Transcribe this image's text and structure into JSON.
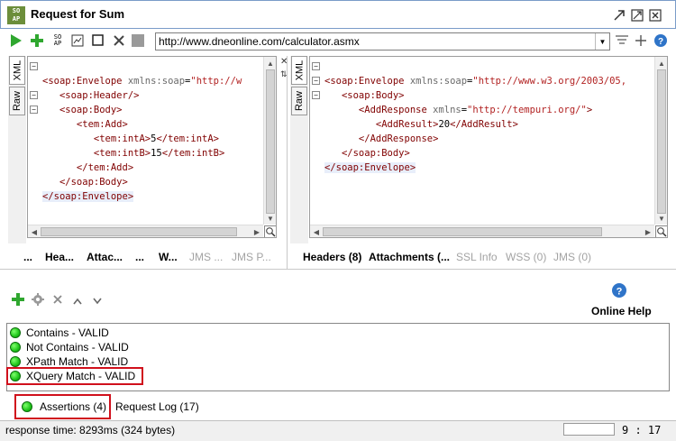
{
  "window": {
    "title": "Request for Sum",
    "app_icon_text": "SO AP"
  },
  "toolbar": {
    "url": "http://www.dneonline.com/calculator.asmx",
    "icons": [
      "run-icon",
      "add-icon",
      "soap-icon",
      "format-icon",
      "stop-icon",
      "cancel-icon",
      "gear-filter-icon",
      "plus-icon",
      "help-icon"
    ]
  },
  "request_editor": {
    "side_tabs": [
      "XML",
      "Raw"
    ],
    "lines": [
      "<soap:Envelope xmlns:soap=\"http://w",
      "   <soap:Header/>",
      "   <soap:Body>",
      "      <tem:Add>",
      "         <tem:intA>5</tem:intA>",
      "         <tem:intB>15</tem:intB>",
      "      </tem:Add>",
      "   </soap:Body>",
      "</soap:Envelope>"
    ],
    "bottom_tabs": [
      "...",
      "Hea...",
      "Attac...",
      "...",
      "W...",
      "JMS ...",
      "JMS P..."
    ]
  },
  "response_editor": {
    "side_tabs": [
      "XML",
      "Raw"
    ],
    "lines": [
      "<soap:Envelope xmlns:soap=\"http://www.w3.org/2003/05,",
      "   <soap:Body>",
      "      <AddResponse xmlns=\"http://tempuri.org/\">",
      "         <AddResult>20</AddResult>",
      "      </AddResponse>",
      "   </soap:Body>",
      "</soap:Envelope>"
    ],
    "bottom_tabs": [
      "Headers (8)",
      "Attachments (...",
      "SSL Info",
      "WSS (0)",
      "JMS (0)"
    ]
  },
  "assertions": {
    "online_help": "Online Help",
    "items": [
      "Contains - VALID",
      "Not Contains - VALID",
      "XPath Match - VALID",
      "XQuery Match - VALID"
    ],
    "tabs": {
      "assertions": "Assertions (4)",
      "request_log": "Request Log (17)"
    }
  },
  "status": {
    "response_time": "response time: 8293ms (324 bytes)",
    "position": "9 : 17"
  },
  "colors": {
    "accent_red": "#d0101c",
    "valid_green": "#1fc51a",
    "tag": "#800000"
  }
}
